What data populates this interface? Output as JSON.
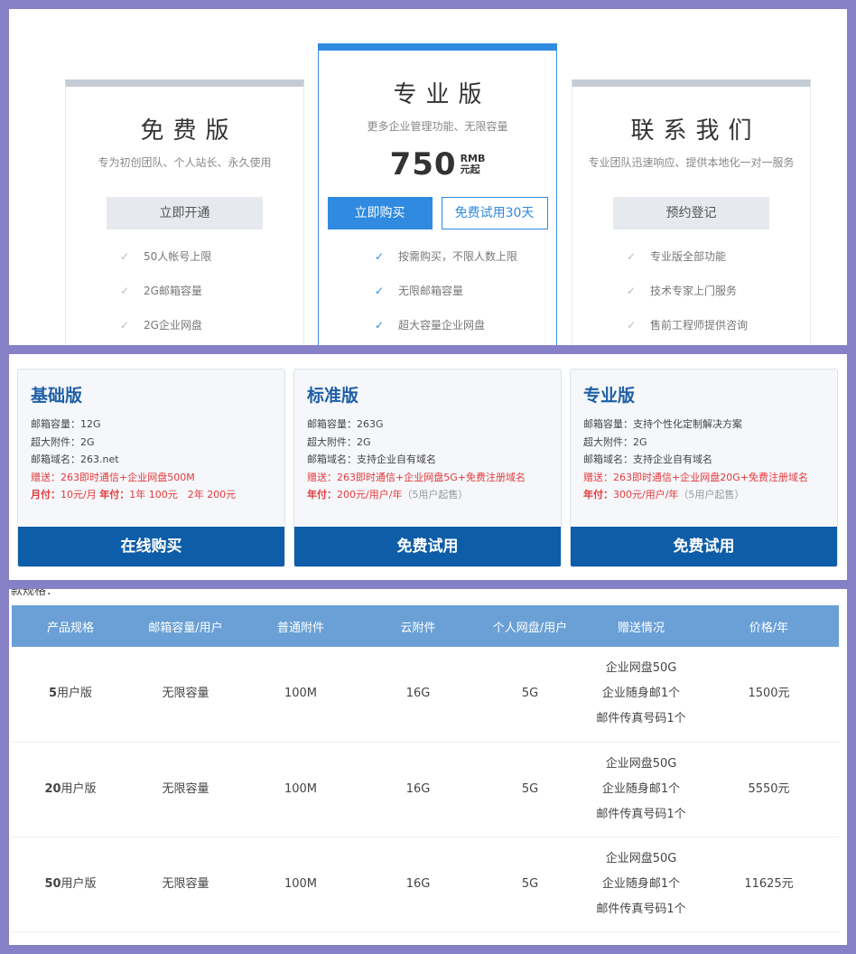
{
  "plans_top": {
    "free": {
      "title": "免费版",
      "desc": "专为初创团队、个人站长、永久使用",
      "button": "立即开通",
      "features": [
        "50人帐号上限",
        "2G邮箱容量",
        "2G企业网盘"
      ]
    },
    "pro": {
      "title": "专业版",
      "desc": "更多企业管理功能、无限容量",
      "price": "750",
      "price_unit_top": "RMB",
      "price_unit_bottom": "元起",
      "button_buy": "立即购买",
      "button_trial": "免费试用30天",
      "features": [
        "按需购买，不限人数上限",
        "无限邮箱容量",
        "超大容量企业网盘"
      ]
    },
    "contact": {
      "title": "联系我们",
      "desc": "专业团队迅速响应、提供本地化一对一服务",
      "button": "预约登记",
      "features": [
        "专业版全部功能",
        "技术专家上门服务",
        "售前工程师提供咨询"
      ]
    }
  },
  "editions": [
    {
      "title": "基础版",
      "lines": [
        "邮箱容量：12G",
        "超大附件：2G",
        "邮箱域名：263.net"
      ],
      "gift": "赠送：263即时通信+企业网盘500M",
      "price_label1": "月付：",
      "price_val1": "10元/月 ",
      "price_label2": "年付：",
      "price_val2": "1年 100元　2年 200元",
      "price_note": "",
      "button": "在线购买"
    },
    {
      "title": "标准版",
      "lines": [
        "邮箱容量：263G",
        "超大附件：2G",
        "邮箱域名：支持企业自有域名"
      ],
      "gift": "赠送：263即时通信+企业网盘5G+免费注册域名",
      "price_label1": "年付：",
      "price_val1": "200元/用户/年",
      "price_label2": "",
      "price_val2": "",
      "price_note": "（5用户起售）",
      "button": "免费试用"
    },
    {
      "title": "专业版",
      "lines": [
        "邮箱容量：支持个性化定制解决方案",
        "超大附件：2G",
        "邮箱域名：支持企业自有域名"
      ],
      "gift": "赠送：263即时通信+企业网盘20G+免费注册域名",
      "price_label1": "年付：",
      "price_val1": "300元/用户/年",
      "price_label2": "",
      "price_val2": "",
      "price_note": "（5用户起售）",
      "button": "免费试用"
    }
  ],
  "table": {
    "cut_text": "款规格：",
    "headers": [
      "产品规格",
      "邮箱容量/用户",
      "普通附件",
      "云附件",
      "个人网盘/用户",
      "赠送情况",
      "价格/年"
    ],
    "rows": [
      {
        "num": "5",
        "name": "用户版",
        "capacity": "无限容量",
        "attach": "100M",
        "cloud": "16G",
        "disk": "5G",
        "gift": [
          "企业网盘50G",
          "企业随身邮1个",
          "邮件传真号码1个"
        ],
        "price": "1500元"
      },
      {
        "num": "20",
        "name": "用户版",
        "capacity": "无限容量",
        "attach": "100M",
        "cloud": "16G",
        "disk": "5G",
        "gift": [
          "企业网盘50G",
          "企业随身邮1个",
          "邮件传真号码1个"
        ],
        "price": "5550元"
      },
      {
        "num": "50",
        "name": "用户版",
        "capacity": "无限容量",
        "attach": "100M",
        "cloud": "16G",
        "disk": "5G",
        "gift": [
          "企业网盘50G",
          "企业随身邮1个",
          "邮件传真号码1个"
        ],
        "price": "11625元"
      }
    ]
  },
  "colors": {
    "frame": "#8680c6",
    "accent_blue": "#2f8ae0",
    "dark_blue": "#0e5da8",
    "table_header": "#6aa0d6",
    "promo_red": "#e4393c"
  },
  "icons": {
    "feature_check": "check-icon"
  }
}
